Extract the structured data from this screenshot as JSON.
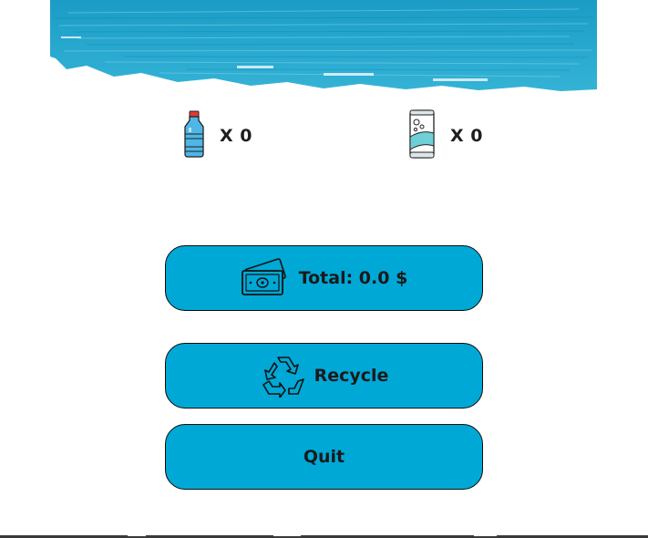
{
  "colors": {
    "accent": "#00a8d6",
    "banner": "#1aa3c9",
    "text": "#1a1a1a"
  },
  "counters": {
    "bottle": {
      "icon": "water-bottle-icon",
      "text": "X 0"
    },
    "can": {
      "icon": "soda-can-icon",
      "text": "X 0"
    }
  },
  "buttons": {
    "total": {
      "icon": "money-bills-icon",
      "label": "Total: 0.0 $"
    },
    "recycle": {
      "icon": "recycle-icon",
      "label": "Recycle"
    },
    "quit": {
      "label": "Quit"
    }
  }
}
